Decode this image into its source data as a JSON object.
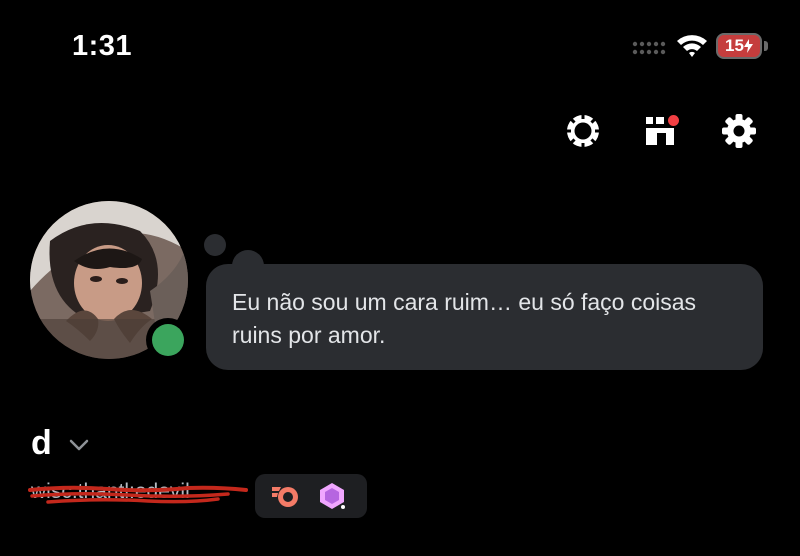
{
  "status_bar": {
    "time": "1:31",
    "battery": "15"
  },
  "header": {
    "icons": [
      "nitro-icon",
      "shop-icon",
      "gear-icon"
    ]
  },
  "profile": {
    "avatar_icon": "avatar",
    "status": "online",
    "status_color": "#3ba55d",
    "custom_status": "Eu não sou um cara ruim… eu só faço coisas ruins por amor.",
    "display_name": "d",
    "username": "wisc:thantl:edevil",
    "badges": [
      "hypesquad-brilliance-icon",
      "nitro-gem-icon"
    ]
  },
  "colors": {
    "background": "#000000",
    "bubble": "#2b2d31",
    "notification": "#f23f43",
    "scribble": "#c4281c"
  }
}
